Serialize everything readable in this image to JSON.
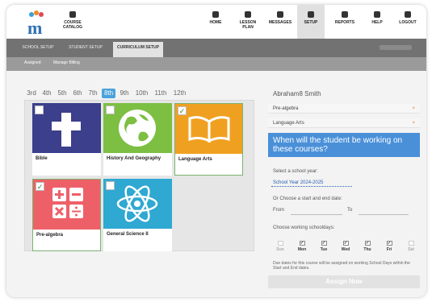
{
  "colors": {
    "accent": "#4aa2d9",
    "tabbar": "#727272",
    "question_box": "#4a90d9"
  },
  "header": {
    "logo_icon": "mindstamp-logo-icon",
    "catalog_label": "COURSE CATALOG",
    "nav": [
      {
        "label": "HOME",
        "icon": "home-icon"
      },
      {
        "label": "LESSON PLAN",
        "icon": "book-icon"
      },
      {
        "label": "MESSAGES",
        "icon": "mail-icon"
      },
      {
        "label": "SETUP",
        "icon": "gear-icon"
      },
      {
        "label": "REPORTS",
        "icon": "grid-icon"
      },
      {
        "label": "HELP",
        "icon": "question-icon"
      },
      {
        "label": "LOGOUT",
        "icon": "power-icon"
      }
    ]
  },
  "tabs": [
    "SCHOOL SETUP",
    "STUDENT SETUP",
    "CURRICULUM SETUP"
  ],
  "subtabs": [
    "Assigned",
    "Manage Billing"
  ],
  "grades": [
    "3rd",
    "4th",
    "5th",
    "6th",
    "7th",
    "8th",
    "9th",
    "10th",
    "11th",
    "12th"
  ],
  "courses": [
    {
      "name": "Bible",
      "checked": false,
      "color": "#3b3f8c",
      "icon": "cross-icon"
    },
    {
      "name": "History And Geography",
      "checked": false,
      "color": "#7cbf42",
      "icon": "globe-icon"
    },
    {
      "name": "Language Arts",
      "checked": true,
      "color": "#f0a020",
      "icon": "open-book-icon"
    },
    {
      "name": "Pre-algebra",
      "checked": true,
      "color": "#ee6068",
      "icon": "math-symbols-icon"
    },
    {
      "name": "General Science II",
      "checked": false,
      "color": "#2fa8d2",
      "icon": "atom-icon"
    }
  ],
  "student": {
    "name": "Abraham8 Smith",
    "assigned": [
      "Pre-algebra",
      "Language Arts"
    ],
    "remove_icon": "x-icon",
    "question": "When will the student be working on these courses?",
    "select_year_label": "Select a school year:",
    "school_year": "School Year 2024-2025",
    "or_choose_label": "Or Choose a start and end date:",
    "from_label": "From",
    "to_label": "To",
    "days_label": "Choose working schooldays:",
    "days": [
      {
        "label": "Sun",
        "checked": false
      },
      {
        "label": "Mon",
        "checked": true
      },
      {
        "label": "Tue",
        "checked": true
      },
      {
        "label": "Wed",
        "checked": true
      },
      {
        "label": "Thu",
        "checked": true
      },
      {
        "label": "Fri",
        "checked": true
      },
      {
        "label": "Sat",
        "checked": false
      }
    ],
    "note": "Due dates for this course will be assigned on working School Days within the Start and End dates.",
    "assign_label": "Assign Now"
  }
}
